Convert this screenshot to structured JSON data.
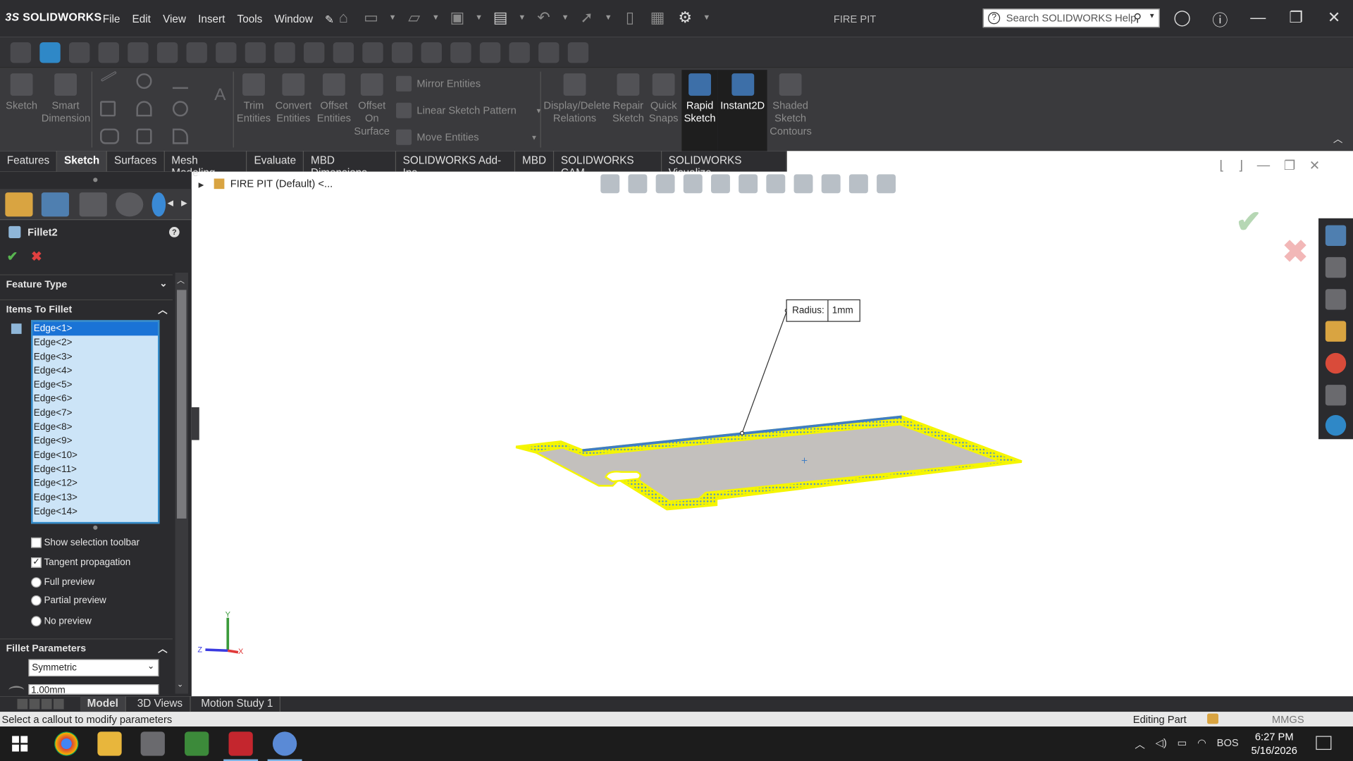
{
  "app": {
    "brand": "SOLIDWORKS",
    "brand_prefix": "3S",
    "document_title": "FIRE PIT"
  },
  "menu": [
    "File",
    "Edit",
    "View",
    "Insert",
    "Tools",
    "Window"
  ],
  "search": {
    "placeholder": "Search SOLIDWORKS Help"
  },
  "ribbon": {
    "sketch": "Sketch",
    "smart_dimension": [
      "Smart",
      "Dimension"
    ],
    "trim": [
      "Trim",
      "Entities"
    ],
    "convert": [
      "Convert",
      "Entities"
    ],
    "offset": [
      "Offset",
      "Entities"
    ],
    "offset_surface": [
      "Offset",
      "On",
      "Surface"
    ],
    "mirror": "Mirror Entities",
    "linear_pattern": "Linear Sketch Pattern",
    "move": "Move Entities",
    "display_delete": [
      "Display/Delete",
      "Relations"
    ],
    "repair": [
      "Repair",
      "Sketch"
    ],
    "quick_snaps": [
      "Quick",
      "Snaps"
    ],
    "rapid_sketch": [
      "Rapid",
      "Sketch"
    ],
    "instant2d": "Instant2D",
    "shaded": [
      "Shaded",
      "Sketch",
      "Contours"
    ]
  },
  "tabs": [
    "Features",
    "Sketch",
    "Surfaces",
    "Mesh Modeling",
    "Evaluate",
    "MBD Dimensions",
    "SOLIDWORKS Add-Ins",
    "MBD",
    "SOLIDWORKS CAM",
    "SOLIDWORKS Visualize"
  ],
  "property_manager": {
    "title": "Fillet2",
    "help": "?",
    "feature_type": "Feature Type",
    "items_to_fillet": "Items To Fillet",
    "edges": [
      "Edge<1>",
      "Edge<2>",
      "Edge<3>",
      "Edge<4>",
      "Edge<5>",
      "Edge<6>",
      "Edge<7>",
      "Edge<8>",
      "Edge<9>",
      "Edge<10>",
      "Edge<11>",
      "Edge<12>",
      "Edge<13>",
      "Edge<14>"
    ],
    "show_selection_toolbar": "Show selection toolbar",
    "tangent_propagation": "Tangent propagation",
    "full_preview": "Full preview",
    "partial_preview": "Partial preview",
    "no_preview": "No preview",
    "fillet_parameters": "Fillet Parameters",
    "symmetric": "Symmetric",
    "radius_field": "1.00mm"
  },
  "graphics": {
    "tree_root": "FIRE PIT (Default) <...",
    "callout_label": "Radius:",
    "callout_value": "1mm",
    "axis_y": "Y",
    "axis_z": "Z",
    "axis_x": "X"
  },
  "bottom_tabs": [
    "Model",
    "3D Views",
    "Motion Study 1"
  ],
  "status": {
    "message": "Select a callout to modify parameters",
    "mode": "Editing Part",
    "units": "MMGS"
  },
  "taskbar": {
    "time": "6:27 PM",
    "date": "5/16/2026",
    "lang": "BOS"
  }
}
